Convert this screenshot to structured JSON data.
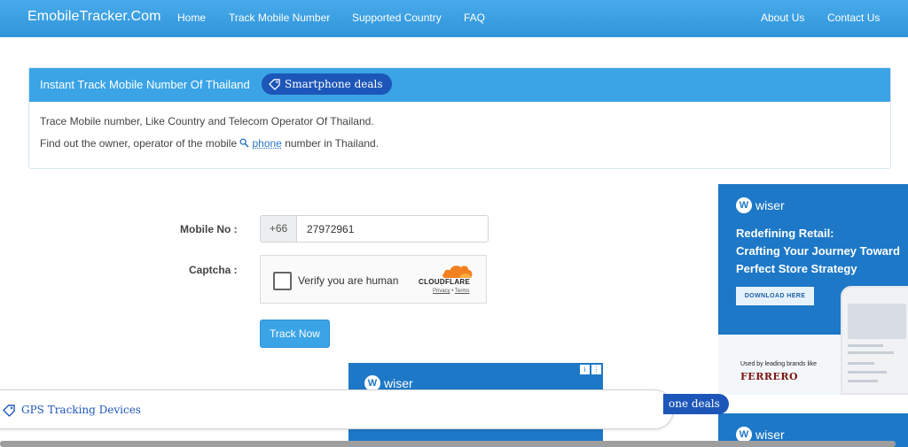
{
  "navbar": {
    "brand": "EmobileTracker.Com",
    "links": [
      "Home",
      "Track Mobile Number",
      "Supported Country",
      "FAQ"
    ],
    "right_links": [
      "About Us",
      "Contact Us"
    ]
  },
  "panel": {
    "title": "Instant Track Mobile Number Of Thailand",
    "deal_label": "Smartphone deals",
    "line1": "Trace Mobile number, Like Country and Telecom Operator Of Thailand.",
    "line2_prefix": "Find out the owner, operator of the mobile",
    "line2_link": "phone",
    "line2_suffix": "number in Thailand."
  },
  "form": {
    "mobile_label": "Mobile No :",
    "country_code": "+66",
    "mobile_value": "27972961",
    "captcha_label": "Captcha :",
    "captcha_text": "Verify you are human",
    "captcha_brand": "CLOUDFLARE",
    "captcha_privacy": "Privacy",
    "captcha_sep": "•",
    "captcha_terms": "Terms",
    "submit_label": "Track Now"
  },
  "ad_right": {
    "logo": "wiser",
    "headline_lines": [
      "Redefining Retail:",
      "Crafting Your Journey Toward",
      "Perfect Store Strategy"
    ],
    "button": "DOWNLOAD HERE",
    "used_by": "Used by leading brands like",
    "brand": "FERRERO"
  },
  "ad_right2": {
    "logo": "wiser"
  },
  "ad_center": {
    "logo": "wiser"
  },
  "bottom": {
    "gps_label": "GPS Tracking Devices",
    "deal_label2": "one deals"
  },
  "colors": {
    "nav": "#3a9fe2",
    "panel_head": "#3aa4e6",
    "pill": "#1d56b9",
    "ad": "#1d78c7",
    "button": "#3aa4e6"
  }
}
